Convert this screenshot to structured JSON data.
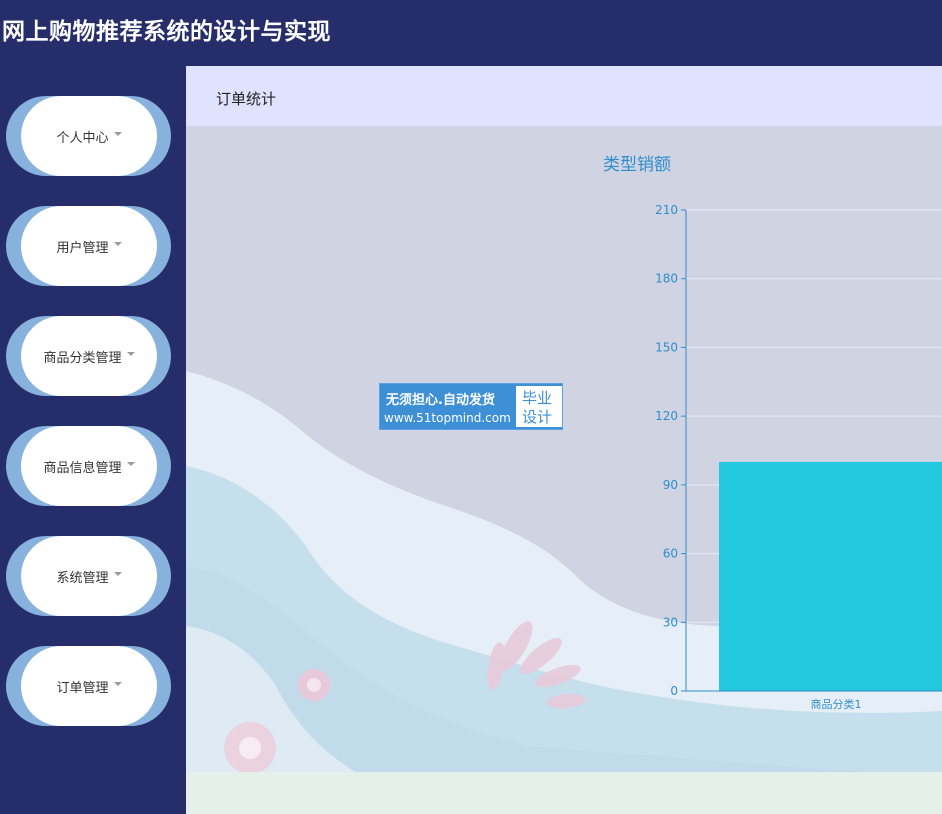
{
  "app": {
    "title": "网上购物推荐系统的设计与实现"
  },
  "sidebar": {
    "items": [
      {
        "label": "个人中心"
      },
      {
        "label": "用户管理"
      },
      {
        "label": "商品分类管理"
      },
      {
        "label": "商品信息管理"
      },
      {
        "label": "系统管理"
      },
      {
        "label": "订单管理"
      }
    ]
  },
  "breadcrumb": {
    "current": "订单统计"
  },
  "watermark": {
    "line1": "无须担心.自动发货",
    "line2": "www.51topmind.com",
    "badge1": "毕业",
    "badge2": "设计"
  },
  "colors": {
    "header_bg": "#262d6b",
    "bar": "#22c8de",
    "axis": "#2f8ecb",
    "menu_accent": "#86b2dd"
  },
  "chart_data": {
    "type": "bar",
    "title": "类型销额",
    "categories": [
      "商品分类1"
    ],
    "values": [
      100
    ],
    "ylim": [
      0,
      210
    ],
    "yticks": [
      0,
      30,
      60,
      90,
      120,
      150,
      180,
      210
    ],
    "grid": true
  }
}
